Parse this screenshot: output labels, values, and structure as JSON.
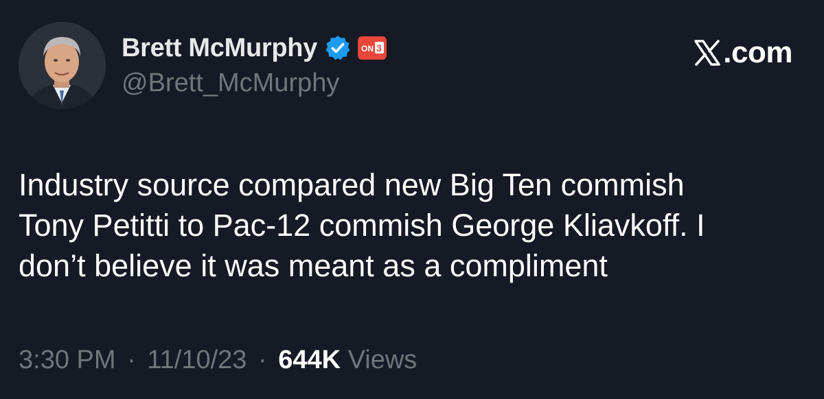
{
  "author": {
    "name": "Brett McMurphy",
    "handle": "@Brett_McMurphy",
    "verified": true,
    "affiliate_badge_text": "ON3",
    "affiliate_badge_color": "#e8473a",
    "verified_color": "#1d9bf0"
  },
  "brand": {
    "logo_icon": "x-logo-icon",
    "domain": ".com"
  },
  "tweet": {
    "text_lines": [
      "Industry source compared new Big Ten commish",
      "Tony Petitti to Pac-12 commish George Kliavkoff. I",
      "don’t believe it was meant as a compliment"
    ]
  },
  "meta": {
    "time": "3:30 PM",
    "date": "11/10/23",
    "views_count": "644K",
    "views_label": "Views",
    "separator": "·"
  },
  "colors": {
    "background": "#151a24",
    "text_primary": "#ffffff",
    "text_secondary": "#71767b"
  }
}
